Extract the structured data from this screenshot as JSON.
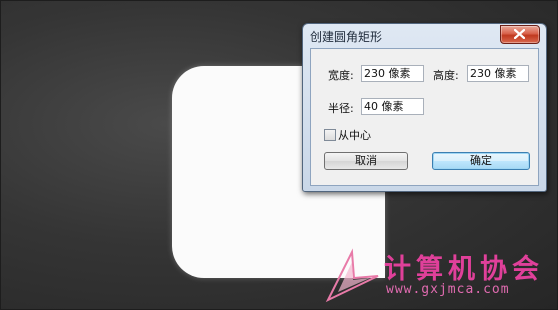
{
  "dialog": {
    "title": "创建圆角矩形",
    "width_label": "宽度:",
    "width_value": "230 像素",
    "height_label": "高度:",
    "height_value": "230 像素",
    "radius_label": "半径:",
    "radius_value": "40 像素",
    "from_center_label": "从中心",
    "from_center_checked": false,
    "cancel_label": "取消",
    "ok_label": "确定"
  },
  "watermark": {
    "text": "计算机协会",
    "url": "www.gxjmca.com"
  },
  "colors": {
    "canvas_bg": "#353535",
    "shape_fill": "#fbfbfb",
    "close_button": "#c8452c",
    "watermark": "#e0409a"
  }
}
